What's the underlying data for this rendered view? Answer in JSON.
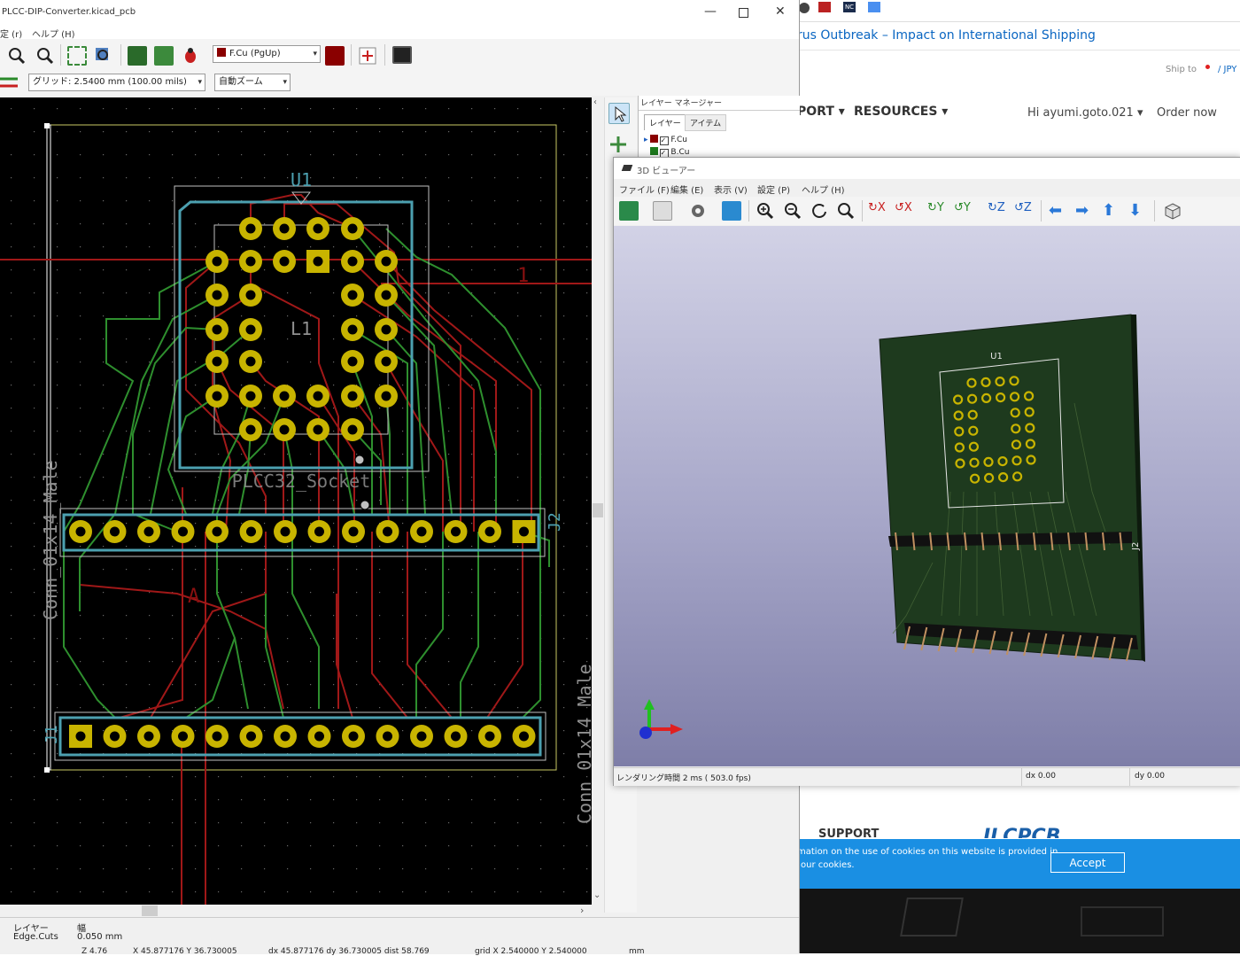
{
  "browser": {
    "headline": "rus Outbreak – Impact on International Shipping",
    "ship_to": "Ship to",
    "currency": "/ JPY",
    "nav_port": "PORT",
    "nav_resources": "RESOURCES",
    "greeting": "Hi ayumi.goto.021",
    "order_now": "Order now",
    "support": "SUPPORT",
    "brand": "JLCPCB",
    "cookie_text_1": "mation on the use of cookies on this website is provided in",
    "cookie_text_2": "our cookies.",
    "accept": "Accept",
    "tab_icon_label": "NC"
  },
  "kicad": {
    "title": "PLCC-DIP-Converter.kicad_pcb",
    "menu_settings": "定 (<u>r</u>)",
    "menu_help": "ヘルプ (H)",
    "layer_select": "F.Cu (PgUp)",
    "grid_select": "グリッド: 2.5400 mm (100.00 mils)",
    "zoom_select": "自動ズーム",
    "board": {
      "ref_u1": "U1",
      "ref_l1": "L1",
      "ref_j2": "J2",
      "ref_j1": "J1",
      "value_socket": "PLCC32_Socket",
      "value_conn1": "Conn_01x14_Male",
      "value_conn2": "Conn_01x14_Male",
      "net_1": "1",
      "net_a": "A",
      "pad_j1": "1"
    },
    "status": {
      "layer_label": "レイヤー",
      "layer_value": "Edge.Cuts",
      "width_label": "幅",
      "width_value": "0.050 mm",
      "z": "Z 4.76",
      "xy": "X 45.877176  Y 36.730005",
      "dxy": "dx 45.877176  dy 36.730005  dist 58.769",
      "grid": "grid X 2.540000  Y 2.540000",
      "units": "mm"
    }
  },
  "layer_manager": {
    "title": "レイヤー マネージャー",
    "tab_layers": "レイヤー",
    "tab_items": "アイテム",
    "layers": [
      "F.Cu",
      "B.Cu"
    ]
  },
  "viewer3d": {
    "title": "3D ビューアー",
    "menus": [
      "ファイル (F)",
      "編集 (E)",
      "表示 (V)",
      "設定 (P)",
      "ヘルプ (H)"
    ],
    "board_ref_u1": "U1",
    "board_ref_j2": "J2",
    "status_render": "レンダリング時間 2 ms ( 503.0 fps)",
    "status_dx": "dx 0.00",
    "status_dy": "dy 0.00"
  },
  "colors": {
    "fcu": "#c83434",
    "bcu": "#4cb04c",
    "pad": "#c8b400",
    "silk": "#4ca0b0",
    "edge": "#c8c864",
    "board3d": "#1e3a1e",
    "accent_blue": "#0a66c2",
    "cookie_bg": "#1a8fe3"
  }
}
